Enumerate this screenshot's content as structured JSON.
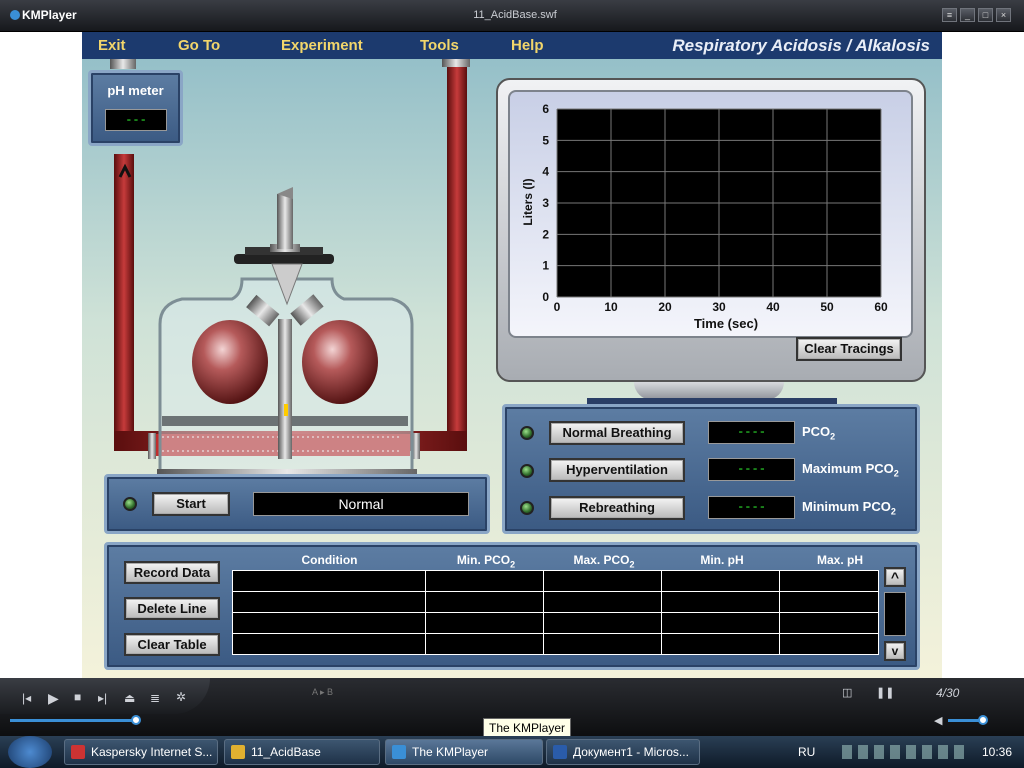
{
  "window": {
    "app_name": "KMPlayer",
    "file_title": "11_AcidBase.swf"
  },
  "menu": {
    "exit": "Exit",
    "goto": "Go To",
    "experiment": "Experiment",
    "tools": "Tools",
    "help": "Help"
  },
  "sim_title": "Respiratory Acidosis / Alkalosis",
  "ph_meter": {
    "label": "pH meter",
    "value": "---"
  },
  "start_panel": {
    "start_label": "Start",
    "status": "Normal"
  },
  "graph": {
    "ylabel": "Liters (l)",
    "xlabel": "Time (sec)",
    "y_ticks": [
      "6",
      "5",
      "4",
      "3",
      "2",
      "1",
      "0"
    ],
    "x_ticks": [
      "0",
      "10",
      "20",
      "30",
      "40",
      "50",
      "60"
    ],
    "clear_label": "Clear Tracings"
  },
  "chart_data": {
    "type": "line",
    "title": "",
    "xlabel": "Time (sec)",
    "ylabel": "Liters (l)",
    "xlim": [
      0,
      60
    ],
    "ylim": [
      0,
      6
    ],
    "grid": true,
    "series": []
  },
  "breathing": {
    "normal": "Normal Breathing",
    "hyper": "Hyperventilation",
    "rebreath": "Rebreathing",
    "pco2_value": "----",
    "max_value": "----",
    "min_value": "----",
    "pco2_label": "PCO",
    "max_label": "Maximum PCO",
    "min_label": "Minimum PCO",
    "sub": "2"
  },
  "data_table": {
    "record": "Record Data",
    "delete": "Delete Line",
    "clear": "Clear Table",
    "col_condition": "Condition",
    "col_min_pco": "Min. PCO",
    "col_max_pco": "Max. PCO",
    "col_min_ph": "Min. pH",
    "col_max_ph": "Max. pH",
    "sub": "2",
    "scroll_up": "^",
    "scroll_down": "v"
  },
  "player": {
    "ab": "A ▸ B",
    "position": "4/30",
    "tooltip": "The KMPlayer"
  },
  "taskbar": {
    "items": [
      "Kaspersky Internet S...",
      "11_AcidBase",
      "The KMPlayer",
      "Документ1 - Micros..."
    ],
    "lang": "RU",
    "clock": "10:36"
  }
}
